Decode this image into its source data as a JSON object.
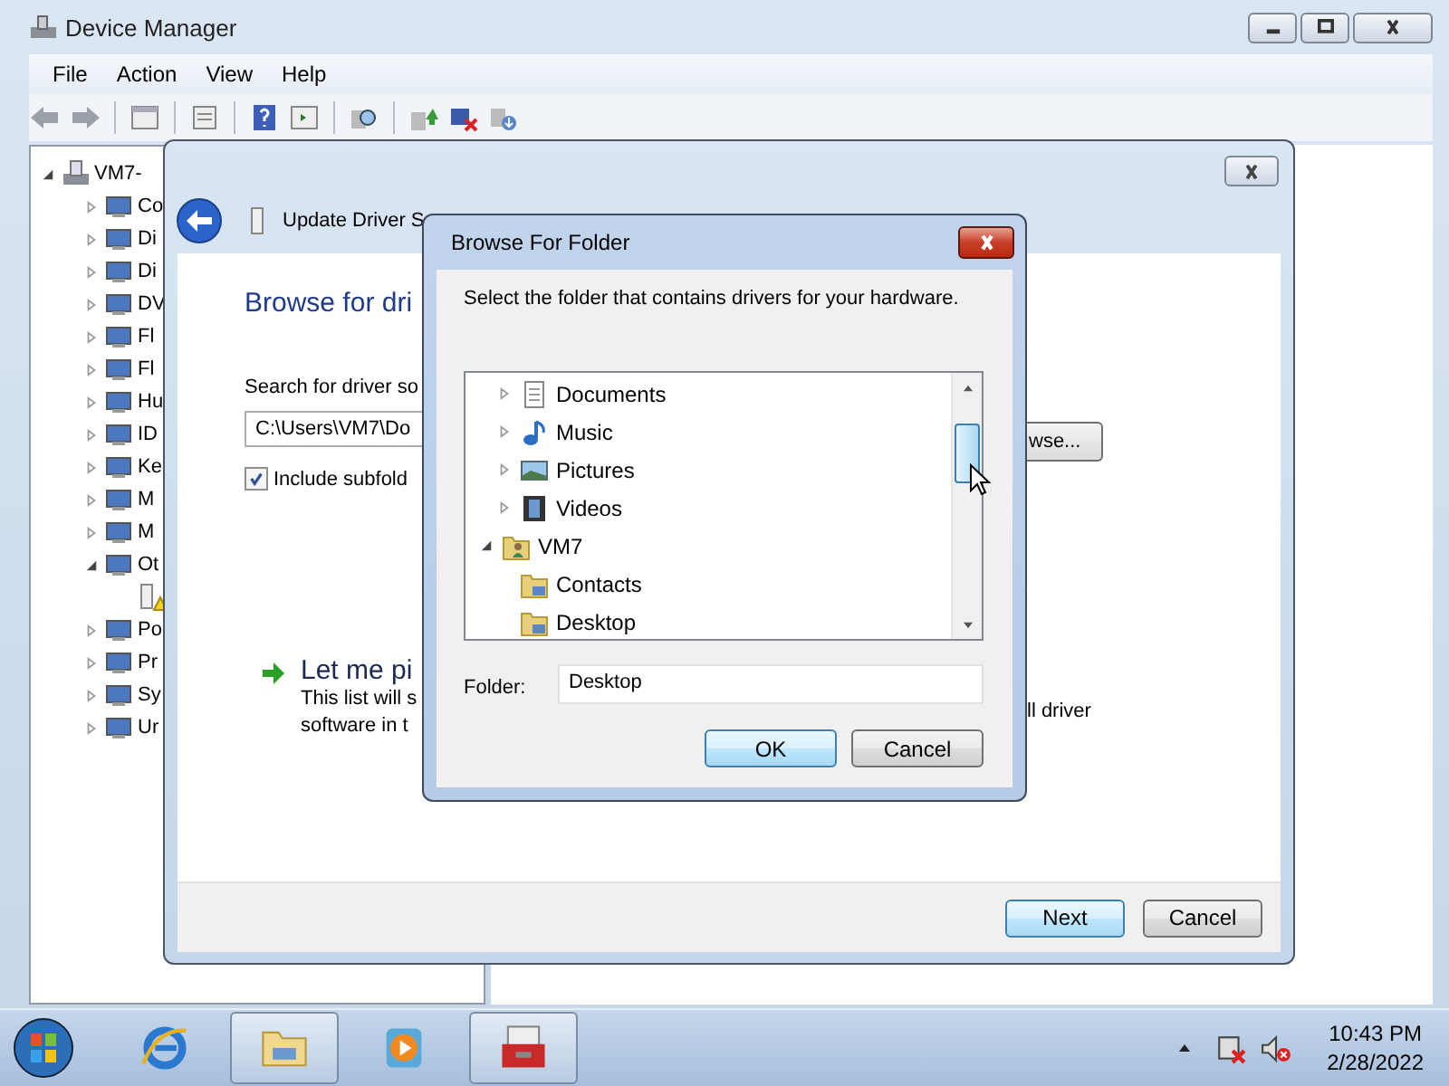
{
  "device_manager": {
    "title": "Device Manager",
    "menu": [
      "File",
      "Action",
      "View",
      "Help"
    ],
    "tree": {
      "label": "VM7-",
      "expanded": true,
      "children": [
        {
          "label": "Co",
          "expanded": false
        },
        {
          "label": "Di",
          "expanded": false
        },
        {
          "label": "Di",
          "expanded": false
        },
        {
          "label": "DV",
          "expanded": false
        },
        {
          "label": "Fl",
          "expanded": false
        },
        {
          "label": "Fl",
          "expanded": false
        },
        {
          "label": "Hu",
          "expanded": false
        },
        {
          "label": "ID",
          "expanded": false
        },
        {
          "label": "Ke",
          "expanded": false
        },
        {
          "label": "M",
          "expanded": false
        },
        {
          "label": "M",
          "expanded": false
        },
        {
          "label": "Ot",
          "expanded": true,
          "children": [
            {
              "kind": "warning-device"
            }
          ]
        },
        {
          "label": "Po",
          "expanded": false
        },
        {
          "label": "Pr",
          "expanded": false
        },
        {
          "label": "Sy",
          "expanded": false
        },
        {
          "label": "Ur",
          "expanded": false
        }
      ]
    }
  },
  "wizard": {
    "header": "Update Driver S",
    "heading": "Browse for dri",
    "search_label": "Search for driver so",
    "path_value": "C:\\Users\\VM7\\Do",
    "browse_button": "wse...",
    "include_subfolders": {
      "label": "Include subfold",
      "checked": true
    },
    "pick_option": {
      "title": "Let me pi",
      "desc_left": [
        "This list will s",
        "software in t"
      ],
      "desc_right": "ll driver"
    },
    "buttons": [
      {
        "label": "Next",
        "default": true
      },
      {
        "label": "Cancel",
        "default": false
      }
    ]
  },
  "browse_dialog": {
    "title": "Browse For Folder",
    "instruction": "Select the folder that contains drivers for your hardware.",
    "folder_tree": [
      {
        "children": [
          {
            "label": "Documents",
            "kind": "document",
            "expanded": false
          },
          {
            "label": "Music",
            "kind": "music",
            "expanded": false
          },
          {
            "label": "Pictures",
            "kind": "pictures",
            "expanded": false
          },
          {
            "label": "Videos",
            "kind": "videos",
            "expanded": false
          }
        ]
      },
      {
        "label": "VM7",
        "kind": "user",
        "expanded": true,
        "children": [
          {
            "label": "Contacts",
            "kind": "folder"
          },
          {
            "label": "Desktop",
            "kind": "folder"
          }
        ]
      }
    ],
    "folder_label": "Folder:",
    "folder_value": "Desktop",
    "buttons": [
      {
        "label": "OK",
        "default": true
      },
      {
        "label": "Cancel",
        "default": false
      }
    ]
  },
  "taskbar": {
    "items": [
      {
        "kind": "ie",
        "running": false
      },
      {
        "kind": "explorer",
        "running": true
      },
      {
        "kind": "media",
        "running": false
      },
      {
        "kind": "toolbox",
        "running": true
      }
    ],
    "time": "10:43 PM",
    "date": "2/28/2022"
  }
}
